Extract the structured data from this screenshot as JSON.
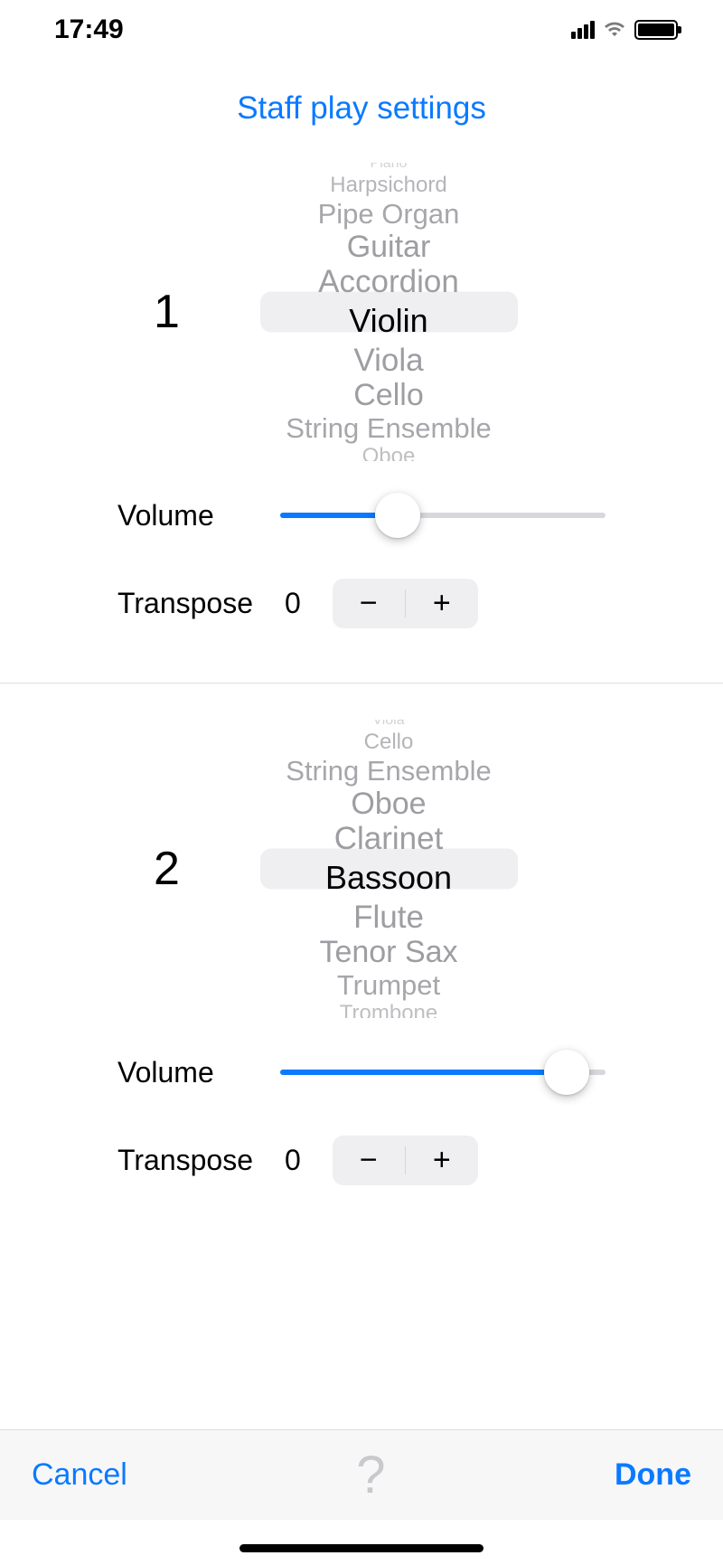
{
  "status": {
    "time": "17:49"
  },
  "title": "Staff play settings",
  "labels": {
    "volume": "Volume",
    "transpose": "Transpose"
  },
  "stepper": {
    "minus": "−",
    "plus": "+"
  },
  "toolbar": {
    "cancel": "Cancel",
    "help": "?",
    "done": "Done"
  },
  "staff": [
    {
      "number": "1",
      "volume_pct": 36,
      "transpose": "0",
      "selected_index": 5,
      "items": [
        {
          "label": "Piano",
          "fs": 16,
          "op": 0.45
        },
        {
          "label": "Harpsichord",
          "fs": 24,
          "op": 0.75
        },
        {
          "label": "Pipe Organ",
          "fs": 31,
          "op": 0.9
        },
        {
          "label": "Guitar",
          "fs": 34,
          "op": 1
        },
        {
          "label": "Accordion",
          "fs": 35,
          "op": 1
        },
        {
          "label": "Violin",
          "fs": 36,
          "op": 1
        },
        {
          "label": "Viola",
          "fs": 35,
          "op": 1
        },
        {
          "label": "Cello",
          "fs": 34,
          "op": 1
        },
        {
          "label": "String Ensemble",
          "fs": 31,
          "op": 0.9
        },
        {
          "label": "Oboe",
          "fs": 24,
          "op": 0.65
        }
      ]
    },
    {
      "number": "2",
      "volume_pct": 88,
      "transpose": "0",
      "selected_index": 5,
      "items": [
        {
          "label": "Viola",
          "fs": 16,
          "op": 0.45
        },
        {
          "label": "Cello",
          "fs": 24,
          "op": 0.75
        },
        {
          "label": "String Ensemble",
          "fs": 31,
          "op": 0.9
        },
        {
          "label": "Oboe",
          "fs": 34,
          "op": 1
        },
        {
          "label": "Clarinet",
          "fs": 35,
          "op": 1
        },
        {
          "label": "Bassoon",
          "fs": 36,
          "op": 1
        },
        {
          "label": "Flute",
          "fs": 35,
          "op": 1
        },
        {
          "label": "Tenor Sax",
          "fs": 34,
          "op": 1
        },
        {
          "label": "Trumpet",
          "fs": 31,
          "op": 0.9
        },
        {
          "label": "Trombone",
          "fs": 24,
          "op": 0.65
        }
      ]
    }
  ]
}
